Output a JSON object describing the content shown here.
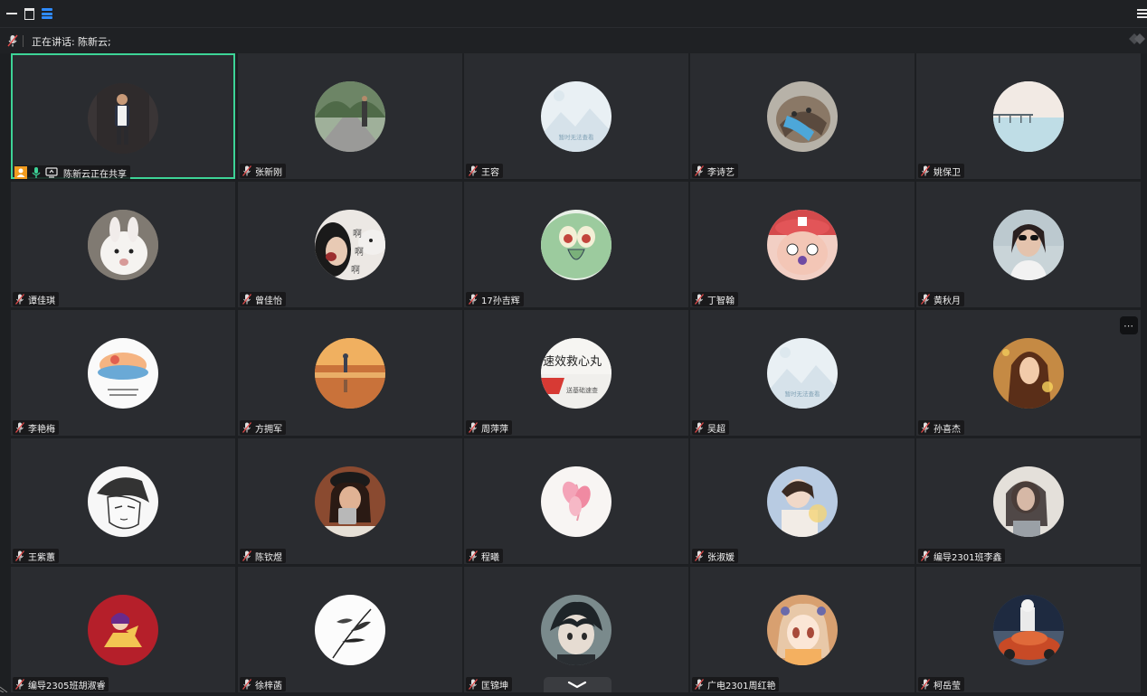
{
  "window": {
    "speaking_label": "正在讲话:",
    "speaking_name": "陈新云;"
  },
  "colors": {
    "active_border": "#3dd497",
    "tile_bg": "#2a2c30",
    "accent_blue": "#2f8bff",
    "share_orange": "#f29c1f",
    "share_green": "#3dd497"
  },
  "icons": {
    "topbar": [
      "minimize-icon",
      "maximize-icon",
      "layout-icon",
      "menu-icon"
    ],
    "nametag_mic": "mic-muted-icon"
  },
  "participants": [
    {
      "name": "陈新云正在共享",
      "avatar": "photo-man-portrait",
      "active": true,
      "sharing": true
    },
    {
      "name": "张新刚",
      "avatar": "photo-road-trees"
    },
    {
      "name": "王容",
      "avatar": "placeholder-unavailable",
      "placeholder_text": "暂时无法查看"
    },
    {
      "name": "李诗艺",
      "avatar": "photo-cat"
    },
    {
      "name": "姚保卫",
      "avatar": "photo-pier-sea"
    },
    {
      "name": "谭佳琪",
      "avatar": "photo-white-rabbit"
    },
    {
      "name": "曾佳怡",
      "avatar": "photo-girl-dog",
      "avatar_text": "啊啊啊"
    },
    {
      "name": "17孙吉辉",
      "avatar": "cartoon-squidward"
    },
    {
      "name": "丁智翰",
      "avatar": "cartoon-chopper"
    },
    {
      "name": "黄秋月",
      "avatar": "photo-woman-sunglasses"
    },
    {
      "name": "李艳梅",
      "avatar": "drawing-sunset-beach"
    },
    {
      "name": "方拥军",
      "avatar": "painting-orange-sunset"
    },
    {
      "name": "周萍萍",
      "avatar": "photo-sign-text",
      "avatar_text": "速效救心丸"
    },
    {
      "name": "吴超",
      "avatar": "placeholder-unavailable",
      "placeholder_text": "暂时无法查看"
    },
    {
      "name": "孙喜杰",
      "avatar": "photo-woman-warm"
    },
    {
      "name": "王紫蕙",
      "avatar": "manga-sketch"
    },
    {
      "name": "陈钦煜",
      "avatar": "photo-girl-cup"
    },
    {
      "name": "程曦",
      "avatar": "photo-pink-flower"
    },
    {
      "name": "张淑媛",
      "avatar": "photo-girl-light"
    },
    {
      "name": "编导2301班李鑫",
      "avatar": "photo-girl-blur"
    },
    {
      "name": "编导2305班胡淑睿",
      "avatar": "cartoon-red-circle"
    },
    {
      "name": "徐梓菡",
      "avatar": "ink-bamboo"
    },
    {
      "name": "匡锦坤",
      "avatar": "anime-boy"
    },
    {
      "name": "广电2301周红艳",
      "avatar": "anime-girl"
    },
    {
      "name": "柯岳莹",
      "avatar": "photo-dog-car"
    }
  ],
  "more_button": "⋯"
}
